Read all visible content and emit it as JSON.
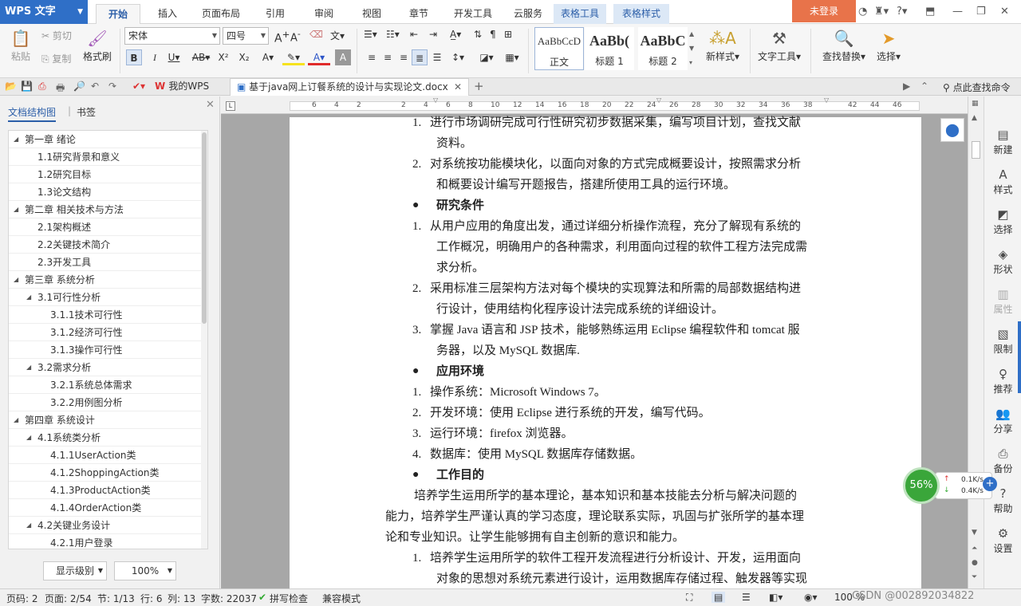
{
  "app": {
    "name": "WPS 文字"
  },
  "menu_tabs": [
    "开始",
    "插入",
    "页面布局",
    "引用",
    "审阅",
    "视图",
    "章节",
    "开发工具",
    "云服务",
    "表格工具",
    "表格样式"
  ],
  "active_tab": "开始",
  "login_label": "未登录",
  "ribbon": {
    "paste": "粘贴",
    "cut": "剪切",
    "copy": "复制",
    "format_painter": "格式刷",
    "font_name": "宋体",
    "font_size": "四号",
    "styles": [
      {
        "preview": "AaBbCcD",
        "label": "正文"
      },
      {
        "preview": "AaBb(",
        "label": "标题 1"
      },
      {
        "preview": "AaBbC",
        "label": "标题 2"
      }
    ],
    "new_style": "新样式",
    "text_tools": "文字工具",
    "find_replace": "查找替换",
    "select": "选择"
  },
  "tabbar": {
    "my_wps": "我的WPS",
    "doc_title": "基于java网上订餐系统的设计与实现论文.docx",
    "search_cmd": "点此查找命令"
  },
  "left_panel": {
    "tab_outline": "文档结构图",
    "tab_bookmark": "书签",
    "tree": [
      {
        "label": "第一章  绪论",
        "level": 0,
        "toggle": "◢"
      },
      {
        "label": "1.1研究背景和意义",
        "level": 1,
        "toggle": ""
      },
      {
        "label": "1.2研究目标",
        "level": 1,
        "toggle": ""
      },
      {
        "label": "1.3论文结构",
        "level": 1,
        "toggle": ""
      },
      {
        "label": "第二章  相关技术与方法",
        "level": 0,
        "toggle": "◢"
      },
      {
        "label": "2.1架构概述",
        "level": 1,
        "toggle": ""
      },
      {
        "label": "2.2关键技术简介",
        "level": 1,
        "toggle": ""
      },
      {
        "label": "2.3开发工具",
        "level": 1,
        "toggle": ""
      },
      {
        "label": "第三章  系统分析",
        "level": 0,
        "toggle": "◢"
      },
      {
        "label": "3.1可行性分析",
        "level": 1,
        "toggle": "◢"
      },
      {
        "label": "3.1.1技术可行性",
        "level": 2,
        "toggle": ""
      },
      {
        "label": "3.1.2经济可行性",
        "level": 2,
        "toggle": ""
      },
      {
        "label": "3.1.3操作可行性",
        "level": 2,
        "toggle": ""
      },
      {
        "label": "3.2需求分析",
        "level": 1,
        "toggle": "◢"
      },
      {
        "label": "3.2.1系统总体需求",
        "level": 2,
        "toggle": ""
      },
      {
        "label": "3.2.2用例图分析",
        "level": 2,
        "toggle": ""
      },
      {
        "label": "第四章  系统设计",
        "level": 0,
        "toggle": "◢"
      },
      {
        "label": "4.1系统类分析",
        "level": 1,
        "toggle": "◢"
      },
      {
        "label": "4.1.1UserAction类",
        "level": 2,
        "toggle": ""
      },
      {
        "label": "4.1.2ShoppingAction类",
        "level": 2,
        "toggle": ""
      },
      {
        "label": "4.1.3ProductAction类",
        "level": 2,
        "toggle": ""
      },
      {
        "label": "4.1.4OrderAction类",
        "level": 2,
        "toggle": ""
      },
      {
        "label": "4.2关键业务设计",
        "level": 1,
        "toggle": "◢"
      },
      {
        "label": "4.2.1用户登录",
        "level": 2,
        "toggle": ""
      }
    ],
    "display_level": "显示级别",
    "zoom": "100%"
  },
  "ruler_numbers": [
    "6",
    "4",
    "2",
    "",
    "2",
    "4",
    "6",
    "8",
    "10",
    "12",
    "14",
    "16",
    "18",
    "20",
    "22",
    "24",
    "26",
    "28",
    "30",
    "32",
    "34",
    "36",
    "38",
    "",
    "42",
    "44",
    "46"
  ],
  "document": {
    "lines": [
      {
        "num": "1.",
        "text": "进行市场调研完成可行性研究初步数据采集，编写项目计划，查找文献"
      },
      {
        "num": "",
        "text": "资料。"
      },
      {
        "num": "2.",
        "text": "对系统按功能模块化，以面向对象的方式完成概要设计，按照需求分析"
      },
      {
        "num": "",
        "text": "和概要设计编写开题报告，搭建所使用工具的运行环境。"
      },
      {
        "num": "●",
        "text": "研究条件",
        "head": true
      },
      {
        "num": "1.",
        "text": "从用户应用的角度出发，通过详细分析操作流程，充分了解现有系统的"
      },
      {
        "num": "",
        "text": "工作概况，明确用户的各种需求，利用面向过程的软件工程方法完成需"
      },
      {
        "num": "",
        "text": "求分析。"
      },
      {
        "num": "2.",
        "text": "采用标准三层架构方法对每个模块的实现算法和所需的局部数据结构进"
      },
      {
        "num": "",
        "text": "行设计，使用结构化程序设计法完成系统的详细设计。"
      },
      {
        "num": "3.",
        "text": "掌握 Java 语言和 JSP 技术，能够熟练运用 Eclipse 编程软件和 tomcat 服"
      },
      {
        "num": "",
        "text": "务器，以及 MySQL 数据库."
      },
      {
        "num": "●",
        "text": "应用环境",
        "head": true
      },
      {
        "num": "1.",
        "text": "操作系统：Microsoft Windows 7。"
      },
      {
        "num": "2.",
        "text": "开发环境：使用 Eclipse 进行系统的开发，编写代码。"
      },
      {
        "num": "3.",
        "text": "运行环境：firefox 浏览器。"
      },
      {
        "num": "4.",
        "text": "数据库：使用 MySQL 数据库存储数据。"
      },
      {
        "num": "●",
        "text": "工作目的",
        "head": true
      },
      {
        "num": "",
        "text": "培养学生运用所学的基本理论，基本知识和基本技能去分析与解决问题的"
      },
      {
        "num": "",
        "text": "能力，培养学生严谨认真的学习态度，理论联系实际，巩固与扩张所学的基本理"
      },
      {
        "num": "",
        "text": "论和专业知识。让学生能够拥有自主创新的意识和能力。"
      },
      {
        "num": "1.",
        "text": "培养学生运用所学的软件工程开发流程进行分析设计、开发，运用面向"
      },
      {
        "num": "",
        "text": "对象的思想对系统元素进行设计，运用数据库存储过程、触发器等实现"
      }
    ]
  },
  "right_rail": [
    {
      "label": "新建",
      "icon": "▤"
    },
    {
      "label": "样式",
      "icon": "A"
    },
    {
      "label": "选择",
      "icon": "◩"
    },
    {
      "label": "形状",
      "icon": "◈"
    },
    {
      "label": "属性",
      "icon": "▥",
      "gray": true
    },
    {
      "label": "限制",
      "icon": "▧"
    },
    {
      "label": "推荐",
      "icon": "♀"
    },
    {
      "label": "分享",
      "icon": "👥"
    },
    {
      "label": "备份",
      "icon": "⎙"
    },
    {
      "label": "帮助",
      "icon": "?"
    },
    {
      "label": "设置",
      "icon": "⚙"
    }
  ],
  "widget": {
    "percent": "56%",
    "up": "0.1K/s",
    "down": "0.4K/s"
  },
  "status": {
    "page_code": "页码: 2",
    "page": "页面: 2/54",
    "section": "节: 1/13",
    "row": "行: 6",
    "col": "列: 13",
    "words": "字数: 22037",
    "spell": "拼写检查",
    "compat": "兼容模式",
    "zoom": "100 %",
    "watermark": "CSDN @002892034822"
  }
}
